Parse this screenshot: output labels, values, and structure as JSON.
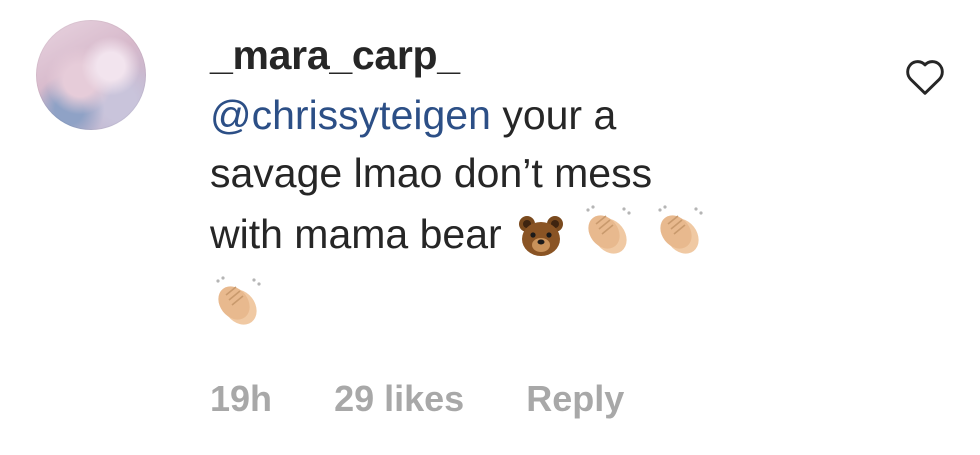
{
  "comment": {
    "username": "_mara_carp_",
    "mention": "@chrissyteigen",
    "text_line1": "your a",
    "text_line2": "savage lmao don’t mess",
    "text_line3": "with mama bear",
    "emojis": [
      "bear-face",
      "clapping-hands",
      "clapping-hands",
      "clapping-hands"
    ],
    "time": "19h",
    "likes": "29 likes",
    "reply_label": "Reply"
  },
  "colors": {
    "text": "#262626",
    "mention": "#2c4f86",
    "meta": "#a8a8a8"
  }
}
